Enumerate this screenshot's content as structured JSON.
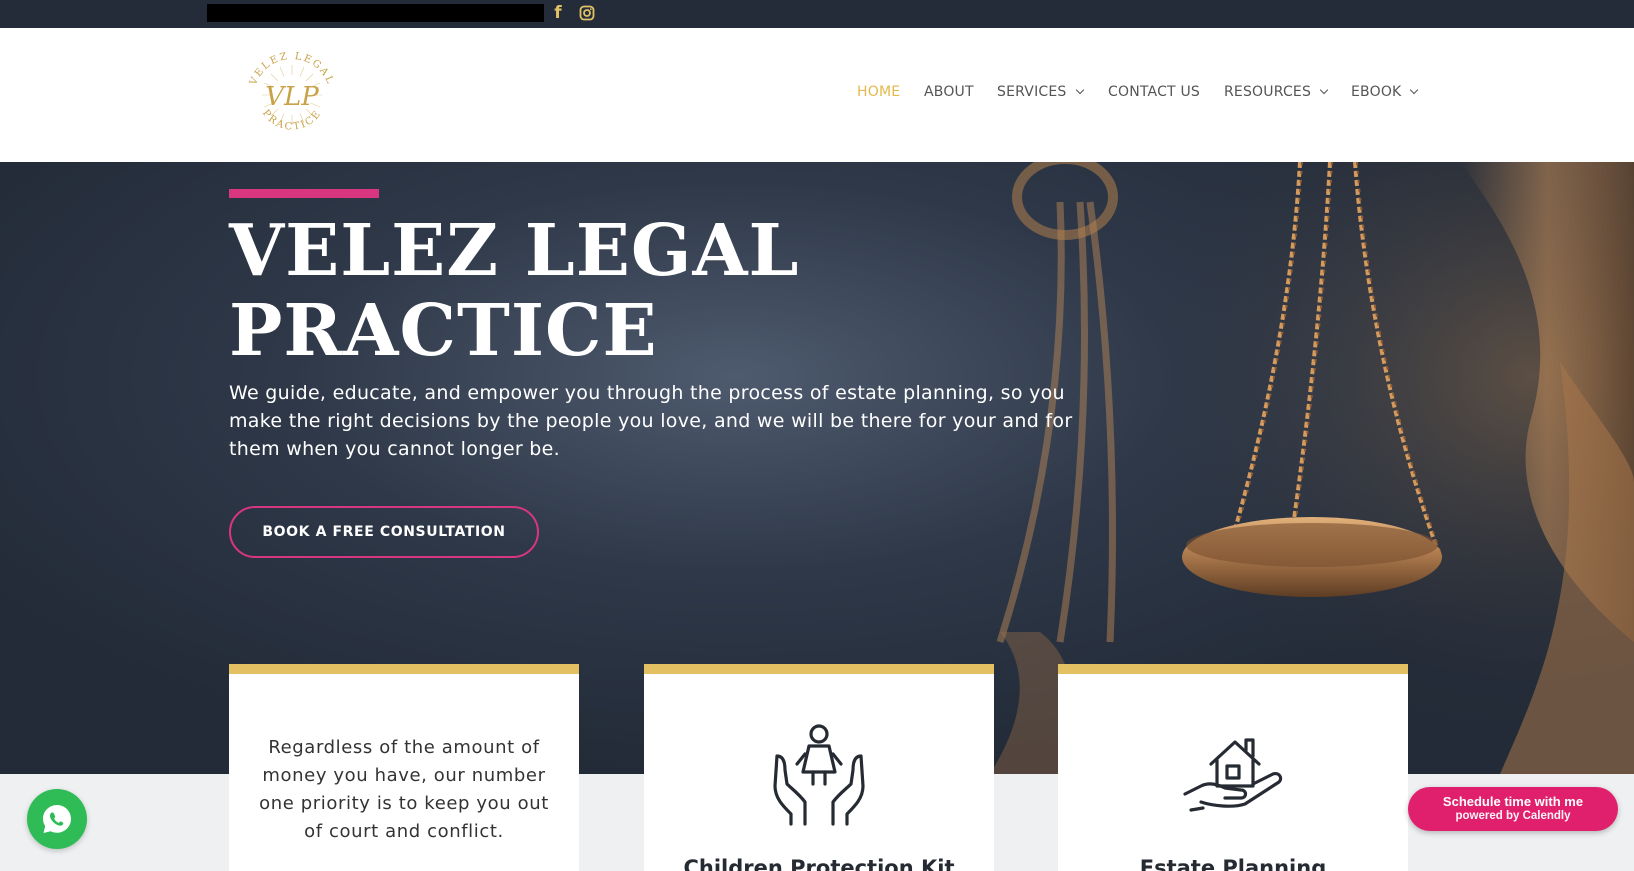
{
  "topbar": {
    "social": [
      "facebook-icon",
      "instagram-icon"
    ],
    "facebook_glyph": "f"
  },
  "brand": {
    "logo_text_top": "VELEZ LEGAL",
    "logo_text_bottom": "PRACTICE",
    "logo_monogram": "VLP",
    "logo_color": "#c9a247"
  },
  "nav": {
    "items": [
      {
        "label": "HOME",
        "active": true,
        "dropdown": false
      },
      {
        "label": "ABOUT",
        "active": false,
        "dropdown": false
      },
      {
        "label": "SERVICES",
        "active": false,
        "dropdown": true
      },
      {
        "label": "CONTACT US",
        "active": false,
        "dropdown": false
      },
      {
        "label": "RESOURCES",
        "active": false,
        "dropdown": true
      },
      {
        "label": "EBOOK",
        "active": false,
        "dropdown": true
      }
    ]
  },
  "hero": {
    "title_line1": "VELEZ LEGAL",
    "title_line2": "PRACTICE",
    "subtitle": "We guide, educate, and empower you through the process of estate planning, so you make the right decisions by the people you love, and we will be there for your and for them when you cannot longer be.",
    "cta_label": "BOOK A FREE CONSULTATION",
    "background_image": "scales-of-justice"
  },
  "cards": [
    {
      "text": "Regardless of the amount of money you have, our number one priority is to keep you out of court and conflict."
    },
    {
      "title": "Children Protection Kit",
      "icon": "child-in-hands-icon"
    },
    {
      "title": "Estate Planning",
      "icon": "house-in-hand-icon"
    }
  ],
  "widgets": {
    "whatsapp_icon": "whatsapp-icon",
    "calendly_line1": "Schedule time with me",
    "calendly_line2": "powered by Calendly"
  },
  "colors": {
    "accent_pink": "#d93680",
    "accent_gold": "#e3c062",
    "nav_active": "#e3b94b",
    "topbar": "#242c3a",
    "whatsapp": "#2fbc57",
    "calendly": "#e0206d"
  }
}
